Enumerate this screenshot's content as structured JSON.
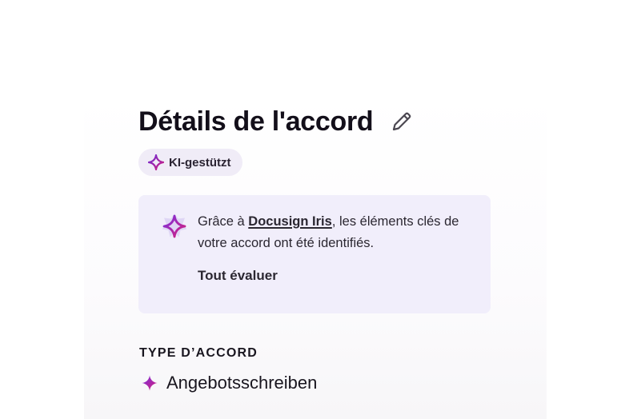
{
  "header": {
    "title": "Détails de l'accord",
    "edit_icon": "pencil-icon"
  },
  "badge": {
    "label": "KI-gestützt",
    "icon": "sparkle-icon"
  },
  "info_card": {
    "icon": "iris-sparkle-icon",
    "text_before": "Grâce à ",
    "link_text": "Docusign Iris",
    "text_after": ", les éléments clés de votre accord ont été identifiés.",
    "review_label": "Tout évaluer"
  },
  "agreement_type": {
    "heading": "TYPE D’ACCORD",
    "value": "Angebotsschreiben",
    "icon": "sparkle-icon"
  },
  "colors": {
    "card_background": "#f1eefb",
    "badge_background": "#f0ecf7",
    "sparkle_magenta": "#c21f86",
    "sparkle_purple": "#6b2bd6",
    "text_primary": "#19161f"
  }
}
